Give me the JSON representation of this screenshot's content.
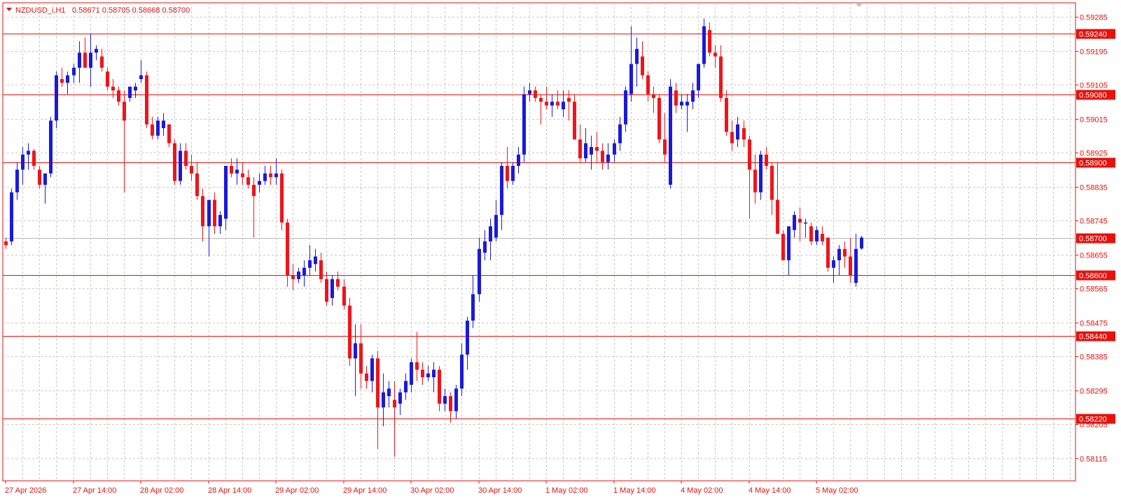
{
  "header": {
    "symbol": "NZDUSD_i,H1",
    "ohlc": "0.58671 0.58705 0.58668 0.58700"
  },
  "colors": {
    "background": "#ffffff",
    "frame": "#e8110b",
    "grid": "#c8c8c8",
    "bull": "#1a1adb",
    "bear": "#f0141a",
    "level_line": "#e8110b",
    "label_bg": "#e8110b",
    "label_text": "#ffffff",
    "axis_text": "#e8110b"
  },
  "chart_data": {
    "type": "candlestick",
    "symbol": "NZDUSD_i",
    "timeframe": "H1",
    "y_axis": {
      "ylim": [
        0.5808,
        0.5933
      ],
      "ticks": [
        "0.59285",
        "0.59195",
        "0.59105",
        "0.59015",
        "0.58925",
        "0.58835",
        "0.58745",
        "0.58655",
        "0.58565",
        "0.58475",
        "0.58385",
        "0.58295",
        "0.58205",
        "0.58115"
      ]
    },
    "x_axis": {
      "ticks": [
        "27 Apr 2026",
        "27 Apr 14:00",
        "28 Apr 02:00",
        "28 Apr 14:00",
        "29 Apr 02:00",
        "29 Apr 14:00",
        "30 Apr 02:00",
        "30 Apr 14:00",
        "1 May 02:00",
        "1 May 14:00",
        "4 May 02:00",
        "4 May 14:00",
        "5 May 02:00"
      ],
      "tick_bars": [
        0,
        12,
        24,
        36,
        48,
        60,
        72,
        84,
        96,
        108,
        120,
        132,
        144
      ]
    },
    "grid": true,
    "levels": [
      0.5924,
      0.5908,
      0.589,
      0.586,
      0.5844,
      0.5822
    ],
    "level_labels": [
      "0.59240",
      "0.59080",
      "0.58900",
      "0.58600",
      "0.58440",
      "0.58220"
    ],
    "current_price": 0.587,
    "current_price_label": "0.58700",
    "candles_ohlc": [
      [
        0.5869,
        0.587,
        0.5867,
        0.5868
      ],
      [
        0.5869,
        0.5883,
        0.5868,
        0.5882
      ],
      [
        0.5882,
        0.589,
        0.588,
        0.5888
      ],
      [
        0.5888,
        0.5894,
        0.5884,
        0.5892
      ],
      [
        0.5892,
        0.5895,
        0.5888,
        0.5893
      ],
      [
        0.5893,
        0.58935,
        0.5888,
        0.5889
      ],
      [
        0.5888,
        0.5889,
        0.5883,
        0.5884
      ],
      [
        0.5884,
        0.5887,
        0.5879,
        0.5887
      ],
      [
        0.5887,
        0.5902,
        0.5886,
        0.5901
      ],
      [
        0.5901,
        0.5914,
        0.5899,
        0.5913
      ],
      [
        0.5912,
        0.5915,
        0.591,
        0.5911
      ],
      [
        0.5911,
        0.5914,
        0.5908,
        0.5913
      ],
      [
        0.5913,
        0.5916,
        0.5911,
        0.5915
      ],
      [
        0.5915,
        0.5922,
        0.5911,
        0.5919
      ],
      [
        0.5919,
        0.5923,
        0.5915,
        0.5915
      ],
      [
        0.5915,
        0.5924,
        0.591,
        0.5919
      ],
      [
        0.5919,
        0.5921,
        0.5917,
        0.592
      ],
      [
        0.5918,
        0.592,
        0.5914,
        0.5915
      ],
      [
        0.5914,
        0.5915,
        0.5909,
        0.591
      ],
      [
        0.591,
        0.5912,
        0.5907,
        0.5909
      ],
      [
        0.5909,
        0.591,
        0.5905,
        0.5906
      ],
      [
        0.5906,
        0.5909,
        0.5882,
        0.5901
      ],
      [
        0.5907,
        0.591,
        0.5906,
        0.591
      ],
      [
        0.5909,
        0.5911,
        0.5907,
        0.591
      ],
      [
        0.5912,
        0.5917,
        0.5911,
        0.5913
      ],
      [
        0.5913,
        0.5914,
        0.5899,
        0.59
      ],
      [
        0.59,
        0.5902,
        0.5896,
        0.5897
      ],
      [
        0.5897,
        0.5902,
        0.5896,
        0.5901
      ],
      [
        0.5899,
        0.5903,
        0.5897,
        0.5901
      ],
      [
        0.59,
        0.59,
        0.5894,
        0.5895
      ],
      [
        0.5895,
        0.5896,
        0.5884,
        0.5885
      ],
      [
        0.5885,
        0.5895,
        0.5884,
        0.5893
      ],
      [
        0.5893,
        0.5895,
        0.5888,
        0.5889
      ],
      [
        0.5889,
        0.5892,
        0.5885,
        0.5887
      ],
      [
        0.5887,
        0.589,
        0.588,
        0.5881
      ],
      [
        0.5881,
        0.5883,
        0.5869,
        0.5873
      ],
      [
        0.5873,
        0.588,
        0.5865,
        0.588
      ],
      [
        0.588,
        0.5882,
        0.5871,
        0.5873
      ],
      [
        0.5873,
        0.5877,
        0.5871,
        0.5876
      ],
      [
        0.5875,
        0.5884,
        0.5872,
        0.5889
      ],
      [
        0.5889,
        0.5891,
        0.5886,
        0.5887
      ],
      [
        0.5887,
        0.5891,
        0.5884,
        0.5888
      ],
      [
        0.5887,
        0.589,
        0.5884,
        0.5886
      ],
      [
        0.5886,
        0.5888,
        0.5883,
        0.5884
      ],
      [
        0.5884,
        0.5886,
        0.587,
        0.5881
      ],
      [
        0.5884,
        0.5887,
        0.5882,
        0.5885
      ],
      [
        0.5885,
        0.5889,
        0.5884,
        0.5887
      ],
      [
        0.5887,
        0.5889,
        0.5884,
        0.5886
      ],
      [
        0.5886,
        0.5891,
        0.5884,
        0.5887
      ],
      [
        0.5887,
        0.5888,
        0.5872,
        0.5874
      ],
      [
        0.5874,
        0.5875,
        0.5857,
        0.586
      ],
      [
        0.586,
        0.5863,
        0.5856,
        0.5859
      ],
      [
        0.5859,
        0.5862,
        0.5858,
        0.5861
      ],
      [
        0.586,
        0.5864,
        0.5857,
        0.5862
      ],
      [
        0.5862,
        0.5868,
        0.586,
        0.5864
      ],
      [
        0.5863,
        0.5867,
        0.5861,
        0.5865
      ],
      [
        0.5864,
        0.5866,
        0.5858,
        0.5859
      ],
      [
        0.5859,
        0.5861,
        0.5852,
        0.5853
      ],
      [
        0.5854,
        0.586,
        0.5852,
        0.5859
      ],
      [
        0.5859,
        0.5861,
        0.5856,
        0.5857
      ],
      [
        0.5857,
        0.5859,
        0.5851,
        0.5852
      ],
      [
        0.5852,
        0.5854,
        0.5836,
        0.5838
      ],
      [
        0.5838,
        0.5847,
        0.5828,
        0.5842
      ],
      [
        0.5842,
        0.5847,
        0.583,
        0.5834
      ],
      [
        0.5834,
        0.5836,
        0.583,
        0.5832
      ],
      [
        0.5832,
        0.5839,
        0.5829,
        0.5838
      ],
      [
        0.5838,
        0.584,
        0.5814,
        0.5825
      ],
      [
        0.5825,
        0.5834,
        0.582,
        0.5829
      ],
      [
        0.5828,
        0.5832,
        0.5825,
        0.583
      ],
      [
        0.5827,
        0.5832,
        0.5812,
        0.5825
      ],
      [
        0.5826,
        0.583,
        0.5823,
        0.5829
      ],
      [
        0.5829,
        0.5834,
        0.5827,
        0.5832
      ],
      [
        0.5831,
        0.5838,
        0.5829,
        0.5837
      ],
      [
        0.5837,
        0.5845,
        0.5832,
        0.5835
      ],
      [
        0.5835,
        0.5837,
        0.5831,
        0.5833
      ],
      [
        0.5833,
        0.5836,
        0.5832,
        0.5834
      ],
      [
        0.5833,
        0.5837,
        0.5829,
        0.5835
      ],
      [
        0.5835,
        0.5836,
        0.5824,
        0.5826
      ],
      [
        0.5826,
        0.583,
        0.5824,
        0.5828
      ],
      [
        0.5828,
        0.5829,
        0.5821,
        0.5824
      ],
      [
        0.5824,
        0.5831,
        0.5822,
        0.583
      ],
      [
        0.583,
        0.5842,
        0.5828,
        0.5839
      ],
      [
        0.5839,
        0.5849,
        0.5835,
        0.5848
      ],
      [
        0.5848,
        0.586,
        0.5846,
        0.5855
      ],
      [
        0.5855,
        0.587,
        0.5853,
        0.5867
      ],
      [
        0.5866,
        0.5872,
        0.5864,
        0.5869
      ],
      [
        0.5869,
        0.5875,
        0.5864,
        0.5873
      ],
      [
        0.587,
        0.588,
        0.5869,
        0.5876
      ],
      [
        0.5876,
        0.589,
        0.5872,
        0.5889
      ],
      [
        0.5889,
        0.5894,
        0.5883,
        0.5885
      ],
      [
        0.5885,
        0.589,
        0.5884,
        0.5889
      ],
      [
        0.5889,
        0.5894,
        0.5887,
        0.5892
      ],
      [
        0.5892,
        0.591,
        0.589,
        0.5908
      ],
      [
        0.5908,
        0.5911,
        0.5906,
        0.5909
      ],
      [
        0.5909,
        0.591,
        0.5906,
        0.5907
      ],
      [
        0.5907,
        0.5908,
        0.59,
        0.5906
      ],
      [
        0.5906,
        0.591,
        0.5904,
        0.5905
      ],
      [
        0.5905,
        0.5908,
        0.5902,
        0.5906
      ],
      [
        0.5906,
        0.5909,
        0.5904,
        0.5905
      ],
      [
        0.5904,
        0.5909,
        0.5902,
        0.5906
      ],
      [
        0.5907,
        0.5909,
        0.5901,
        0.5906
      ],
      [
        0.5906,
        0.5908,
        0.5896,
        0.5896
      ],
      [
        0.5896,
        0.59,
        0.589,
        0.5891
      ],
      [
        0.5891,
        0.5899,
        0.589,
        0.5895
      ],
      [
        0.5892,
        0.5897,
        0.5888,
        0.5894
      ],
      [
        0.5894,
        0.5898,
        0.589,
        0.5893
      ],
      [
        0.5893,
        0.5895,
        0.5888,
        0.589
      ],
      [
        0.589,
        0.5895,
        0.5888,
        0.5892
      ],
      [
        0.5892,
        0.5896,
        0.589,
        0.5895
      ],
      [
        0.5895,
        0.5902,
        0.5893,
        0.59
      ],
      [
        0.59,
        0.591,
        0.5898,
        0.5909
      ],
      [
        0.5908,
        0.5926,
        0.5906,
        0.5916
      ],
      [
        0.5916,
        0.5923,
        0.591,
        0.592
      ],
      [
        0.5918,
        0.5922,
        0.5912,
        0.5913
      ],
      [
        0.5913,
        0.5914,
        0.5906,
        0.5908
      ],
      [
        0.5908,
        0.591,
        0.5903,
        0.5907
      ],
      [
        0.5907,
        0.5908,
        0.5895,
        0.5896
      ],
      [
        0.5896,
        0.5903,
        0.589,
        0.5892
      ],
      [
        0.5884,
        0.5912,
        0.5883,
        0.591
      ],
      [
        0.5909,
        0.5911,
        0.5903,
        0.5905
      ],
      [
        0.5905,
        0.5908,
        0.5904,
        0.5906
      ],
      [
        0.5905,
        0.5908,
        0.5898,
        0.5906
      ],
      [
        0.5906,
        0.5911,
        0.5904,
        0.5909
      ],
      [
        0.5909,
        0.5916,
        0.5907,
        0.5916
      ],
      [
        0.5916,
        0.5928,
        0.5915,
        0.5926
      ],
      [
        0.5925,
        0.5927,
        0.5918,
        0.5919
      ],
      [
        0.5919,
        0.5921,
        0.5915,
        0.5918
      ],
      [
        0.5918,
        0.5921,
        0.5906,
        0.5907
      ],
      [
        0.5907,
        0.5909,
        0.5897,
        0.5898
      ],
      [
        0.5898,
        0.5901,
        0.5893,
        0.5895
      ],
      [
        0.5896,
        0.5902,
        0.5894,
        0.59
      ],
      [
        0.5899,
        0.5901,
        0.5894,
        0.5896
      ],
      [
        0.5896,
        0.5897,
        0.5875,
        0.5888
      ],
      [
        0.5888,
        0.5892,
        0.5879,
        0.5882
      ],
      [
        0.5882,
        0.5893,
        0.588,
        0.5892
      ],
      [
        0.5892,
        0.5894,
        0.5888,
        0.5889
      ],
      [
        0.5889,
        0.589,
        0.5876,
        0.588
      ],
      [
        0.588,
        0.589,
        0.5874,
        0.5871
      ],
      [
        0.5871,
        0.5872,
        0.5865,
        0.5864
      ],
      [
        0.5864,
        0.5869,
        0.586,
        0.5873
      ],
      [
        0.5872,
        0.5877,
        0.587,
        0.5876
      ],
      [
        0.5875,
        0.5878,
        0.5869,
        0.5874
      ],
      [
        0.5874,
        0.5875,
        0.587,
        0.5874
      ],
      [
        0.5873,
        0.5874,
        0.5868,
        0.5869
      ],
      [
        0.5869,
        0.5873,
        0.5868,
        0.5872
      ],
      [
        0.5871,
        0.5873,
        0.5868,
        0.5869
      ],
      [
        0.587,
        0.587,
        0.5861,
        0.5862
      ],
      [
        0.5862,
        0.5865,
        0.5858,
        0.5864
      ],
      [
        0.5864,
        0.5868,
        0.586,
        0.5867
      ],
      [
        0.5867,
        0.5869,
        0.5862,
        0.5865
      ],
      [
        0.5865,
        0.587,
        0.5858,
        0.586
      ],
      [
        0.5858,
        0.5871,
        0.5857,
        0.5867
      ],
      [
        0.58671,
        0.58705,
        0.58668,
        0.587
      ]
    ]
  }
}
